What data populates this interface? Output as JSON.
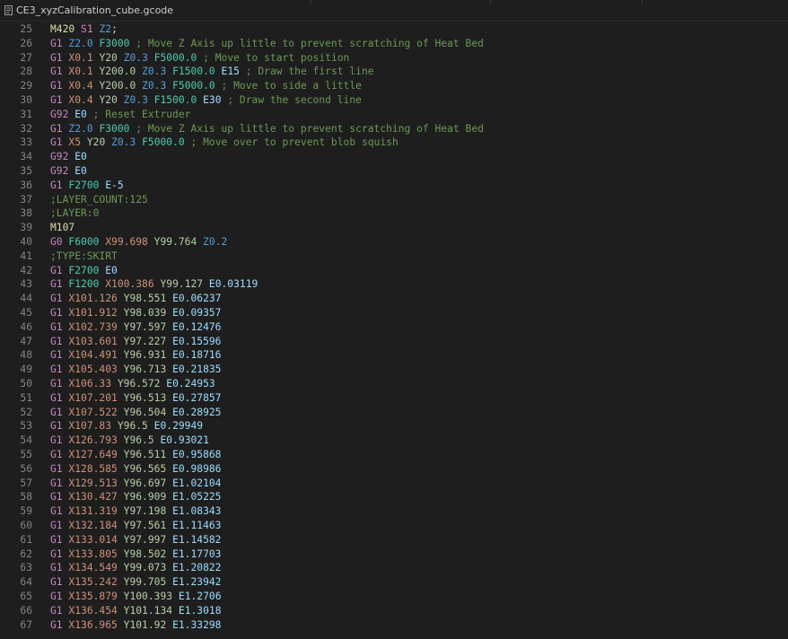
{
  "tab": {
    "title": "CE3_xyzCalibration_cube.gcode",
    "icon": "file-lines-icon"
  },
  "colors": {
    "background": "#1e1e1e",
    "line_number": "#858585",
    "g_command": "#c586c0",
    "m_command": "#dcdcaa",
    "x_param": "#ce9178",
    "y_param": "#b5cea8",
    "z_param": "#569cd6",
    "f_param": "#4ec9b0",
    "e_param": "#9cdcfe",
    "comment": "#6a9955"
  },
  "lines": [
    {
      "n": "25",
      "tokens": [
        {
          "t": "M420",
          "k": "m"
        },
        {
          "t": " "
        },
        {
          "t": "S1",
          "k": "p"
        },
        {
          "t": " "
        },
        {
          "t": "Z2",
          "k": "z"
        },
        {
          "t": ";"
        }
      ]
    },
    {
      "n": "26",
      "tokens": [
        {
          "t": "G1",
          "k": "g"
        },
        {
          "t": " "
        },
        {
          "t": "Z2.0",
          "k": "z"
        },
        {
          "t": " "
        },
        {
          "t": "F3000",
          "k": "f"
        },
        {
          "t": " ; Move Z Axis up little to prevent scratching of Heat Bed",
          "k": "c"
        }
      ]
    },
    {
      "n": "27",
      "tokens": [
        {
          "t": "G1",
          "k": "g"
        },
        {
          "t": " "
        },
        {
          "t": "X0.1",
          "k": "x"
        },
        {
          "t": " "
        },
        {
          "t": "Y20",
          "k": "y"
        },
        {
          "t": " "
        },
        {
          "t": "Z0.3",
          "k": "z"
        },
        {
          "t": " "
        },
        {
          "t": "F5000.0",
          "k": "f"
        },
        {
          "t": " ; Move to start position",
          "k": "c"
        }
      ]
    },
    {
      "n": "28",
      "tokens": [
        {
          "t": "G1",
          "k": "g"
        },
        {
          "t": " "
        },
        {
          "t": "X0.1",
          "k": "x"
        },
        {
          "t": " "
        },
        {
          "t": "Y200.0",
          "k": "y"
        },
        {
          "t": " "
        },
        {
          "t": "Z0.3",
          "k": "z"
        },
        {
          "t": " "
        },
        {
          "t": "F1500.0",
          "k": "f"
        },
        {
          "t": " "
        },
        {
          "t": "E15",
          "k": "e"
        },
        {
          "t": " ; Draw the first line",
          "k": "c"
        }
      ]
    },
    {
      "n": "29",
      "tokens": [
        {
          "t": "G1",
          "k": "g"
        },
        {
          "t": " "
        },
        {
          "t": "X0.4",
          "k": "x"
        },
        {
          "t": " "
        },
        {
          "t": "Y200.0",
          "k": "y"
        },
        {
          "t": " "
        },
        {
          "t": "Z0.3",
          "k": "z"
        },
        {
          "t": " "
        },
        {
          "t": "F5000.0",
          "k": "f"
        },
        {
          "t": " ; Move to side a little",
          "k": "c"
        }
      ]
    },
    {
      "n": "30",
      "tokens": [
        {
          "t": "G1",
          "k": "g"
        },
        {
          "t": " "
        },
        {
          "t": "X0.4",
          "k": "x"
        },
        {
          "t": " "
        },
        {
          "t": "Y20",
          "k": "y"
        },
        {
          "t": " "
        },
        {
          "t": "Z0.3",
          "k": "z"
        },
        {
          "t": " "
        },
        {
          "t": "F1500.0",
          "k": "f"
        },
        {
          "t": " "
        },
        {
          "t": "E30",
          "k": "e"
        },
        {
          "t": " ; Draw the second line",
          "k": "c"
        }
      ]
    },
    {
      "n": "31",
      "tokens": [
        {
          "t": "G92",
          "k": "g"
        },
        {
          "t": " "
        },
        {
          "t": "E0",
          "k": "e"
        },
        {
          "t": " ; Reset Extruder",
          "k": "c"
        }
      ]
    },
    {
      "n": "32",
      "tokens": [
        {
          "t": "G1",
          "k": "g"
        },
        {
          "t": " "
        },
        {
          "t": "Z2.0",
          "k": "z"
        },
        {
          "t": " "
        },
        {
          "t": "F3000",
          "k": "f"
        },
        {
          "t": " ; Move Z Axis up little to prevent scratching of Heat Bed",
          "k": "c"
        }
      ]
    },
    {
      "n": "33",
      "tokens": [
        {
          "t": "G1",
          "k": "g"
        },
        {
          "t": " "
        },
        {
          "t": "X5",
          "k": "x"
        },
        {
          "t": " "
        },
        {
          "t": "Y20",
          "k": "y"
        },
        {
          "t": " "
        },
        {
          "t": "Z0.3",
          "k": "z"
        },
        {
          "t": " "
        },
        {
          "t": "F5000.0",
          "k": "f"
        },
        {
          "t": " ; Move over to prevent blob squish",
          "k": "c"
        }
      ]
    },
    {
      "n": "34",
      "tokens": [
        {
          "t": "G92",
          "k": "g"
        },
        {
          "t": " "
        },
        {
          "t": "E0",
          "k": "e"
        }
      ]
    },
    {
      "n": "35",
      "tokens": [
        {
          "t": "G92",
          "k": "g"
        },
        {
          "t": " "
        },
        {
          "t": "E0",
          "k": "e"
        }
      ]
    },
    {
      "n": "36",
      "tokens": [
        {
          "t": "G1",
          "k": "g"
        },
        {
          "t": " "
        },
        {
          "t": "F2700",
          "k": "f"
        },
        {
          "t": " "
        },
        {
          "t": "E-5",
          "k": "e"
        }
      ]
    },
    {
      "n": "37",
      "tokens": [
        {
          "t": ";LAYER_COUNT:125",
          "k": "c"
        }
      ]
    },
    {
      "n": "38",
      "tokens": [
        {
          "t": ";LAYER:0",
          "k": "c"
        }
      ]
    },
    {
      "n": "39",
      "tokens": [
        {
          "t": "M107",
          "k": "m"
        }
      ]
    },
    {
      "n": "40",
      "tokens": [
        {
          "t": "G0",
          "k": "g"
        },
        {
          "t": " "
        },
        {
          "t": "F6000",
          "k": "f"
        },
        {
          "t": " "
        },
        {
          "t": "X99.698",
          "k": "x"
        },
        {
          "t": " "
        },
        {
          "t": "Y99.764",
          "k": "y"
        },
        {
          "t": " "
        },
        {
          "t": "Z0.2",
          "k": "z"
        }
      ]
    },
    {
      "n": "41",
      "tokens": [
        {
          "t": ";TYPE:SKIRT",
          "k": "c"
        }
      ]
    },
    {
      "n": "42",
      "tokens": [
        {
          "t": "G1",
          "k": "g"
        },
        {
          "t": " "
        },
        {
          "t": "F2700",
          "k": "f"
        },
        {
          "t": " "
        },
        {
          "t": "E0",
          "k": "e"
        }
      ]
    },
    {
      "n": "43",
      "tokens": [
        {
          "t": "G1",
          "k": "g"
        },
        {
          "t": " "
        },
        {
          "t": "F1200",
          "k": "f"
        },
        {
          "t": " "
        },
        {
          "t": "X100.386",
          "k": "x"
        },
        {
          "t": " "
        },
        {
          "t": "Y99.127",
          "k": "y"
        },
        {
          "t": " "
        },
        {
          "t": "E0.03119",
          "k": "e"
        }
      ]
    },
    {
      "n": "44",
      "tokens": [
        {
          "t": "G1",
          "k": "g"
        },
        {
          "t": " "
        },
        {
          "t": "X101.126",
          "k": "x"
        },
        {
          "t": " "
        },
        {
          "t": "Y98.551",
          "k": "y"
        },
        {
          "t": " "
        },
        {
          "t": "E0.06237",
          "k": "e"
        }
      ]
    },
    {
      "n": "45",
      "tokens": [
        {
          "t": "G1",
          "k": "g"
        },
        {
          "t": " "
        },
        {
          "t": "X101.912",
          "k": "x"
        },
        {
          "t": " "
        },
        {
          "t": "Y98.039",
          "k": "y"
        },
        {
          "t": " "
        },
        {
          "t": "E0.09357",
          "k": "e"
        }
      ]
    },
    {
      "n": "46",
      "tokens": [
        {
          "t": "G1",
          "k": "g"
        },
        {
          "t": " "
        },
        {
          "t": "X102.739",
          "k": "x"
        },
        {
          "t": " "
        },
        {
          "t": "Y97.597",
          "k": "y"
        },
        {
          "t": " "
        },
        {
          "t": "E0.12476",
          "k": "e"
        }
      ]
    },
    {
      "n": "47",
      "tokens": [
        {
          "t": "G1",
          "k": "g"
        },
        {
          "t": " "
        },
        {
          "t": "X103.601",
          "k": "x"
        },
        {
          "t": " "
        },
        {
          "t": "Y97.227",
          "k": "y"
        },
        {
          "t": " "
        },
        {
          "t": "E0.15596",
          "k": "e"
        }
      ]
    },
    {
      "n": "48",
      "tokens": [
        {
          "t": "G1",
          "k": "g"
        },
        {
          "t": " "
        },
        {
          "t": "X104.491",
          "k": "x"
        },
        {
          "t": " "
        },
        {
          "t": "Y96.931",
          "k": "y"
        },
        {
          "t": " "
        },
        {
          "t": "E0.18716",
          "k": "e"
        }
      ]
    },
    {
      "n": "49",
      "tokens": [
        {
          "t": "G1",
          "k": "g"
        },
        {
          "t": " "
        },
        {
          "t": "X105.403",
          "k": "x"
        },
        {
          "t": " "
        },
        {
          "t": "Y96.713",
          "k": "y"
        },
        {
          "t": " "
        },
        {
          "t": "E0.21835",
          "k": "e"
        }
      ]
    },
    {
      "n": "50",
      "tokens": [
        {
          "t": "G1",
          "k": "g"
        },
        {
          "t": " "
        },
        {
          "t": "X106.33",
          "k": "x"
        },
        {
          "t": " "
        },
        {
          "t": "Y96.572",
          "k": "y"
        },
        {
          "t": " "
        },
        {
          "t": "E0.24953",
          "k": "e"
        }
      ]
    },
    {
      "n": "51",
      "tokens": [
        {
          "t": "G1",
          "k": "g"
        },
        {
          "t": " "
        },
        {
          "t": "X107.201",
          "k": "x"
        },
        {
          "t": " "
        },
        {
          "t": "Y96.513",
          "k": "y"
        },
        {
          "t": " "
        },
        {
          "t": "E0.27857",
          "k": "e"
        }
      ]
    },
    {
      "n": "52",
      "tokens": [
        {
          "t": "G1",
          "k": "g"
        },
        {
          "t": " "
        },
        {
          "t": "X107.522",
          "k": "x"
        },
        {
          "t": " "
        },
        {
          "t": "Y96.504",
          "k": "y"
        },
        {
          "t": " "
        },
        {
          "t": "E0.28925",
          "k": "e"
        }
      ]
    },
    {
      "n": "53",
      "tokens": [
        {
          "t": "G1",
          "k": "g"
        },
        {
          "t": " "
        },
        {
          "t": "X107.83",
          "k": "x"
        },
        {
          "t": " "
        },
        {
          "t": "Y96.5",
          "k": "y"
        },
        {
          "t": " "
        },
        {
          "t": "E0.29949",
          "k": "e"
        }
      ]
    },
    {
      "n": "54",
      "tokens": [
        {
          "t": "G1",
          "k": "g"
        },
        {
          "t": " "
        },
        {
          "t": "X126.793",
          "k": "x"
        },
        {
          "t": " "
        },
        {
          "t": "Y96.5",
          "k": "y"
        },
        {
          "t": " "
        },
        {
          "t": "E0.93021",
          "k": "e"
        }
      ]
    },
    {
      "n": "55",
      "tokens": [
        {
          "t": "G1",
          "k": "g"
        },
        {
          "t": " "
        },
        {
          "t": "X127.649",
          "k": "x"
        },
        {
          "t": " "
        },
        {
          "t": "Y96.511",
          "k": "y"
        },
        {
          "t": " "
        },
        {
          "t": "E0.95868",
          "k": "e"
        }
      ]
    },
    {
      "n": "56",
      "tokens": [
        {
          "t": "G1",
          "k": "g"
        },
        {
          "t": " "
        },
        {
          "t": "X128.585",
          "k": "x"
        },
        {
          "t": " "
        },
        {
          "t": "Y96.565",
          "k": "y"
        },
        {
          "t": " "
        },
        {
          "t": "E0.98986",
          "k": "e"
        }
      ]
    },
    {
      "n": "57",
      "tokens": [
        {
          "t": "G1",
          "k": "g"
        },
        {
          "t": " "
        },
        {
          "t": "X129.513",
          "k": "x"
        },
        {
          "t": " "
        },
        {
          "t": "Y96.697",
          "k": "y"
        },
        {
          "t": " "
        },
        {
          "t": "E1.02104",
          "k": "e"
        }
      ]
    },
    {
      "n": "58",
      "tokens": [
        {
          "t": "G1",
          "k": "g"
        },
        {
          "t": " "
        },
        {
          "t": "X130.427",
          "k": "x"
        },
        {
          "t": " "
        },
        {
          "t": "Y96.909",
          "k": "y"
        },
        {
          "t": " "
        },
        {
          "t": "E1.05225",
          "k": "e"
        }
      ]
    },
    {
      "n": "59",
      "tokens": [
        {
          "t": "G1",
          "k": "g"
        },
        {
          "t": " "
        },
        {
          "t": "X131.319",
          "k": "x"
        },
        {
          "t": " "
        },
        {
          "t": "Y97.198",
          "k": "y"
        },
        {
          "t": " "
        },
        {
          "t": "E1.08343",
          "k": "e"
        }
      ]
    },
    {
      "n": "60",
      "tokens": [
        {
          "t": "G1",
          "k": "g"
        },
        {
          "t": " "
        },
        {
          "t": "X132.184",
          "k": "x"
        },
        {
          "t": " "
        },
        {
          "t": "Y97.561",
          "k": "y"
        },
        {
          "t": " "
        },
        {
          "t": "E1.11463",
          "k": "e"
        }
      ]
    },
    {
      "n": "61",
      "tokens": [
        {
          "t": "G1",
          "k": "g"
        },
        {
          "t": " "
        },
        {
          "t": "X133.014",
          "k": "x"
        },
        {
          "t": " "
        },
        {
          "t": "Y97.997",
          "k": "y"
        },
        {
          "t": " "
        },
        {
          "t": "E1.14582",
          "k": "e"
        }
      ]
    },
    {
      "n": "62",
      "tokens": [
        {
          "t": "G1",
          "k": "g"
        },
        {
          "t": " "
        },
        {
          "t": "X133.805",
          "k": "x"
        },
        {
          "t": " "
        },
        {
          "t": "Y98.502",
          "k": "y"
        },
        {
          "t": " "
        },
        {
          "t": "E1.17703",
          "k": "e"
        }
      ]
    },
    {
      "n": "63",
      "tokens": [
        {
          "t": "G1",
          "k": "g"
        },
        {
          "t": " "
        },
        {
          "t": "X134.549",
          "k": "x"
        },
        {
          "t": " "
        },
        {
          "t": "Y99.073",
          "k": "y"
        },
        {
          "t": " "
        },
        {
          "t": "E1.20822",
          "k": "e"
        }
      ]
    },
    {
      "n": "64",
      "tokens": [
        {
          "t": "G1",
          "k": "g"
        },
        {
          "t": " "
        },
        {
          "t": "X135.242",
          "k": "x"
        },
        {
          "t": " "
        },
        {
          "t": "Y99.705",
          "k": "y"
        },
        {
          "t": " "
        },
        {
          "t": "E1.23942",
          "k": "e"
        }
      ]
    },
    {
      "n": "65",
      "tokens": [
        {
          "t": "G1",
          "k": "g"
        },
        {
          "t": " "
        },
        {
          "t": "X135.879",
          "k": "x"
        },
        {
          "t": " "
        },
        {
          "t": "Y100.393",
          "k": "y"
        },
        {
          "t": " "
        },
        {
          "t": "E1.2706",
          "k": "e"
        }
      ]
    },
    {
      "n": "66",
      "tokens": [
        {
          "t": "G1",
          "k": "g"
        },
        {
          "t": " "
        },
        {
          "t": "X136.454",
          "k": "x"
        },
        {
          "t": " "
        },
        {
          "t": "Y101.134",
          "k": "y"
        },
        {
          "t": " "
        },
        {
          "t": "E1.3018",
          "k": "e"
        }
      ]
    },
    {
      "n": "67",
      "tokens": [
        {
          "t": "G1",
          "k": "g"
        },
        {
          "t": " "
        },
        {
          "t": "X136.965",
          "k": "x"
        },
        {
          "t": " "
        },
        {
          "t": "Y101.92",
          "k": "y"
        },
        {
          "t": " "
        },
        {
          "t": "E1.33298",
          "k": "e"
        }
      ]
    }
  ]
}
